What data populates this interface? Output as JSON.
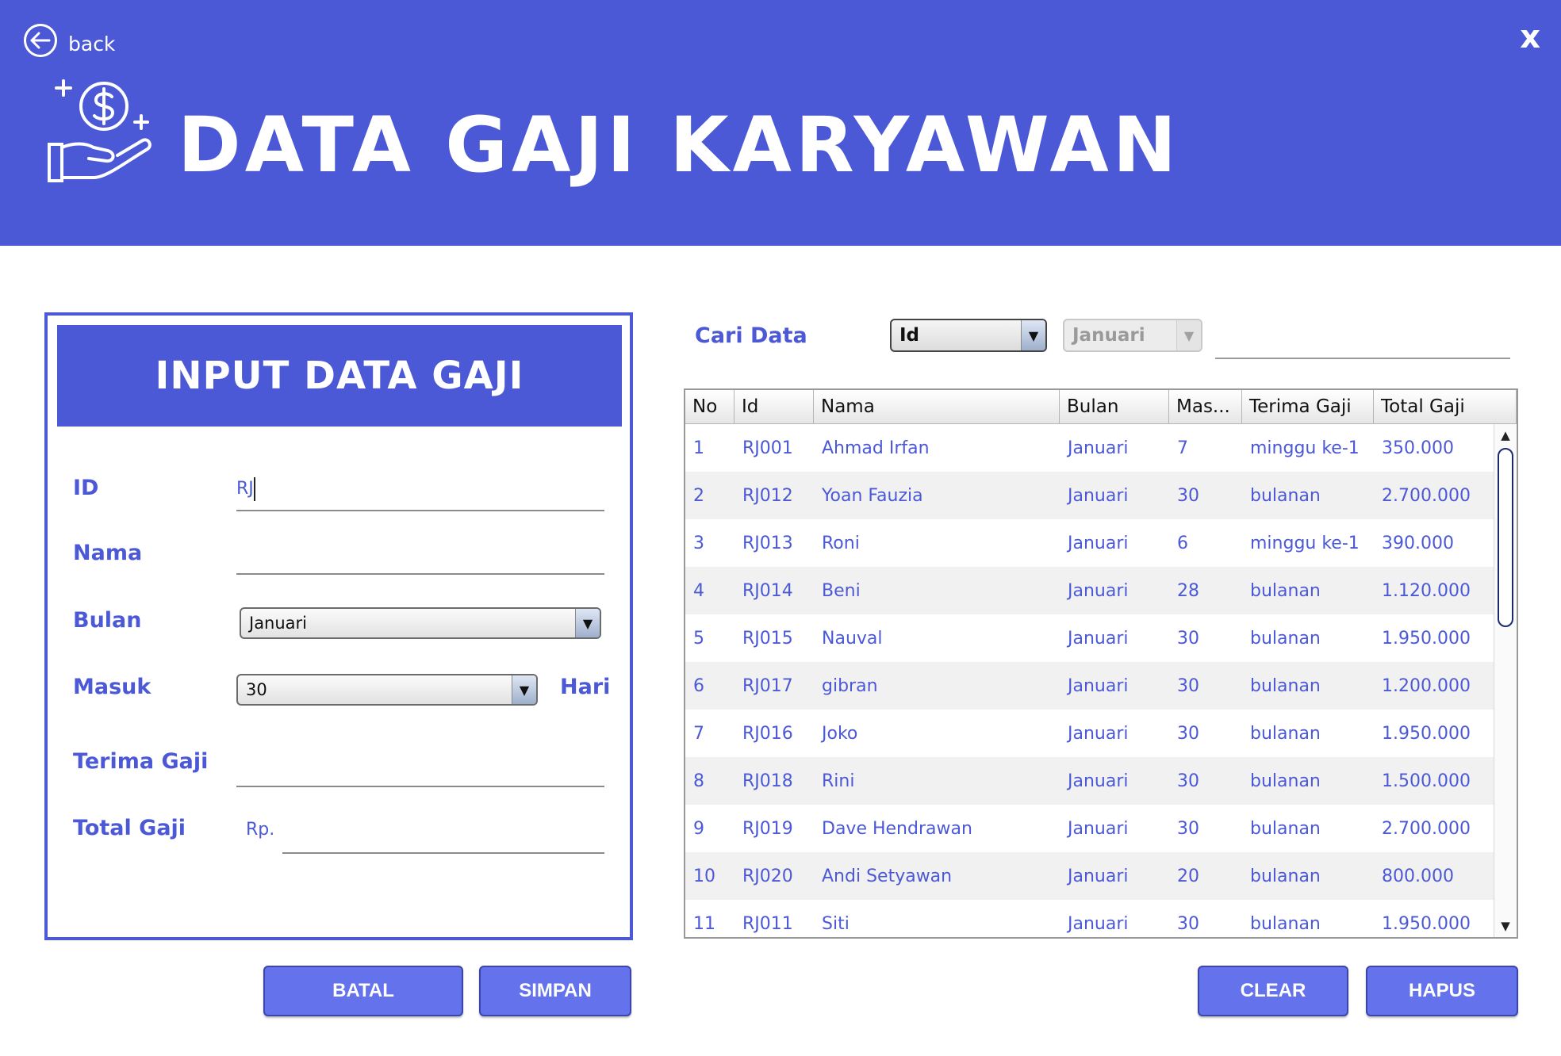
{
  "header": {
    "back_label": "back",
    "close_label": "x",
    "title": "DATA GAJI KARYAWAN",
    "logo_icon": "salary-hand-dollar-icon",
    "background": "#4c59d6"
  },
  "form": {
    "banner": "INPUT DATA GAJI",
    "id_label": "ID",
    "id_value": "RJ",
    "nama_label": "Nama",
    "nama_value": "",
    "bulan_label": "Bulan",
    "bulan_value": "Januari",
    "masuk_label": "Masuk",
    "masuk_value": "30",
    "masuk_unit": "Hari",
    "terima_label": "Terima Gaji",
    "terima_value": "",
    "total_label": "Total Gaji",
    "total_prefix": "Rp.",
    "total_value": ""
  },
  "buttons": {
    "batal": "BATAL",
    "simpan": "SIMPAN",
    "clear": "CLEAR",
    "hapus": "HAPUS"
  },
  "search": {
    "label": "Cari Data",
    "field_value": "Id",
    "month_value": "Januari",
    "query": ""
  },
  "table": {
    "columns": [
      "No",
      "Id",
      "Nama",
      "Bulan",
      "Mas...",
      "Terima Gaji",
      "Total Gaji"
    ],
    "rows": [
      [
        "1",
        "RJ001",
        "Ahmad Irfan",
        "Januari",
        "7",
        "minggu ke-1",
        "350.000"
      ],
      [
        "2",
        "RJ012",
        "Yoan Fauzia",
        "Januari",
        "30",
        "bulanan",
        "2.700.000"
      ],
      [
        "3",
        "RJ013",
        "Roni",
        "Januari",
        "6",
        "minggu ke-1",
        "390.000"
      ],
      [
        "4",
        "RJ014",
        "Beni",
        "Januari",
        "28",
        "bulanan",
        "1.120.000"
      ],
      [
        "5",
        "RJ015",
        "Nauval",
        "Januari",
        "30",
        "bulanan",
        "1.950.000"
      ],
      [
        "6",
        "RJ017",
        "gibran",
        "Januari",
        "30",
        "bulanan",
        "1.200.000"
      ],
      [
        "7",
        "RJ016",
        "Joko",
        "Januari",
        "30",
        "bulanan",
        "1.950.000"
      ],
      [
        "8",
        "RJ018",
        "Rini",
        "Januari",
        "30",
        "bulanan",
        "1.500.000"
      ],
      [
        "9",
        "RJ019",
        "Dave Hendrawan",
        "Januari",
        "30",
        "bulanan",
        "2.700.000"
      ],
      [
        "10",
        "RJ020",
        "Andi Setyawan",
        "Januari",
        "20",
        "bulanan",
        "800.000"
      ],
      [
        "11",
        "RJ011",
        "Siti",
        "Januari",
        "30",
        "bulanan",
        "1.950.000"
      ]
    ]
  }
}
